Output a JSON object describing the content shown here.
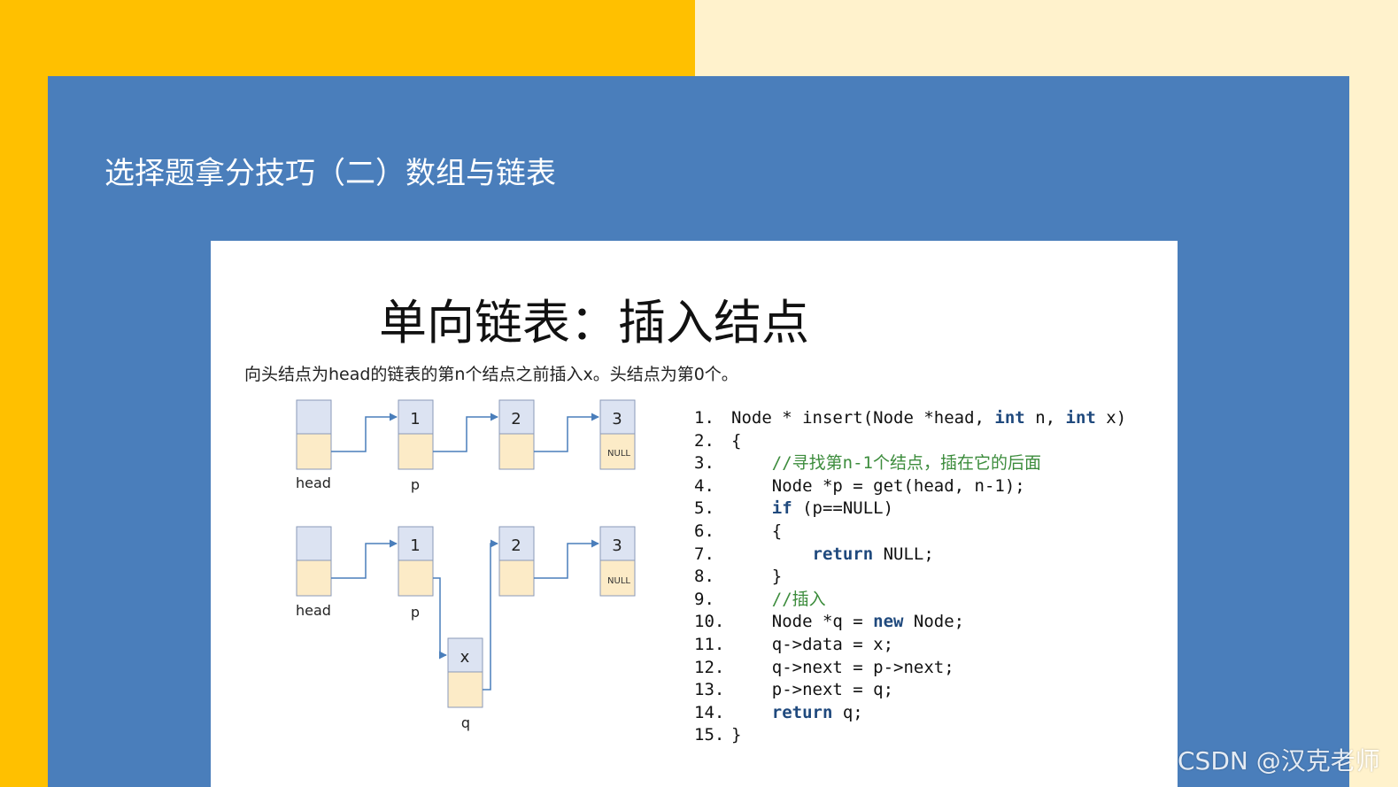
{
  "slide": {
    "title": "选择题拿分技巧（二）数组与链表",
    "colors": {
      "yellow": "#FFC000",
      "cream": "#FFF2CC",
      "blue": "#4A7EBB"
    }
  },
  "image": {
    "title": "单向链表：插入结点",
    "subtitle": "向头结点为head的链表的第n个结点之前插入x。头结点为第0个。",
    "diagram1": {
      "nodes": [
        "",
        "1",
        "2",
        "3"
      ],
      "null_label": "NULL",
      "pointers": [
        "head",
        "p"
      ]
    },
    "diagram2": {
      "nodes": [
        "",
        "1",
        "2",
        "3"
      ],
      "null_label": "NULL",
      "pointers": [
        "head",
        "p"
      ],
      "new_node": "x",
      "new_pointer": "q"
    },
    "code": [
      {
        "n": "1.",
        "parts": [
          {
            "t": "Node * insert(Node *head, "
          },
          {
            "t": "int",
            "k": 1
          },
          {
            "t": " n, "
          },
          {
            "t": "int",
            "k": 1
          },
          {
            "t": " x)"
          }
        ]
      },
      {
        "n": "2.",
        "parts": [
          {
            "t": "{"
          }
        ]
      },
      {
        "n": "3.",
        "parts": [
          {
            "t": "    "
          },
          {
            "t": "//寻找第n-1个结点，插在它的后面",
            "c": 1
          }
        ]
      },
      {
        "n": "4.",
        "parts": [
          {
            "t": "    Node *p = get(head, n-1);"
          }
        ]
      },
      {
        "n": "5.",
        "parts": [
          {
            "t": "    "
          },
          {
            "t": "if",
            "k": 1
          },
          {
            "t": " (p==NULL)"
          }
        ]
      },
      {
        "n": "6.",
        "parts": [
          {
            "t": "    {"
          }
        ]
      },
      {
        "n": "7.",
        "parts": [
          {
            "t": "        "
          },
          {
            "t": "return",
            "k": 1
          },
          {
            "t": " NULL;"
          }
        ]
      },
      {
        "n": "8.",
        "parts": [
          {
            "t": "    }"
          }
        ]
      },
      {
        "n": "9.",
        "parts": [
          {
            "t": "    "
          },
          {
            "t": "//插入",
            "c": 1
          }
        ]
      },
      {
        "n": "10.",
        "parts": [
          {
            "t": "    Node *q = "
          },
          {
            "t": "new",
            "k": 1
          },
          {
            "t": " Node;"
          }
        ]
      },
      {
        "n": "11.",
        "parts": [
          {
            "t": "    q->data = x;"
          }
        ]
      },
      {
        "n": "12.",
        "parts": [
          {
            "t": "    q->next = p->next;"
          }
        ]
      },
      {
        "n": "13.",
        "parts": [
          {
            "t": "    p->next = q;"
          }
        ]
      },
      {
        "n": "14.",
        "parts": [
          {
            "t": "    "
          },
          {
            "t": "return",
            "k": 1
          },
          {
            "t": " q;"
          }
        ]
      },
      {
        "n": "15.",
        "parts": [
          {
            "t": "}"
          }
        ]
      }
    ]
  },
  "watermark": "CSDN @汉克老师"
}
